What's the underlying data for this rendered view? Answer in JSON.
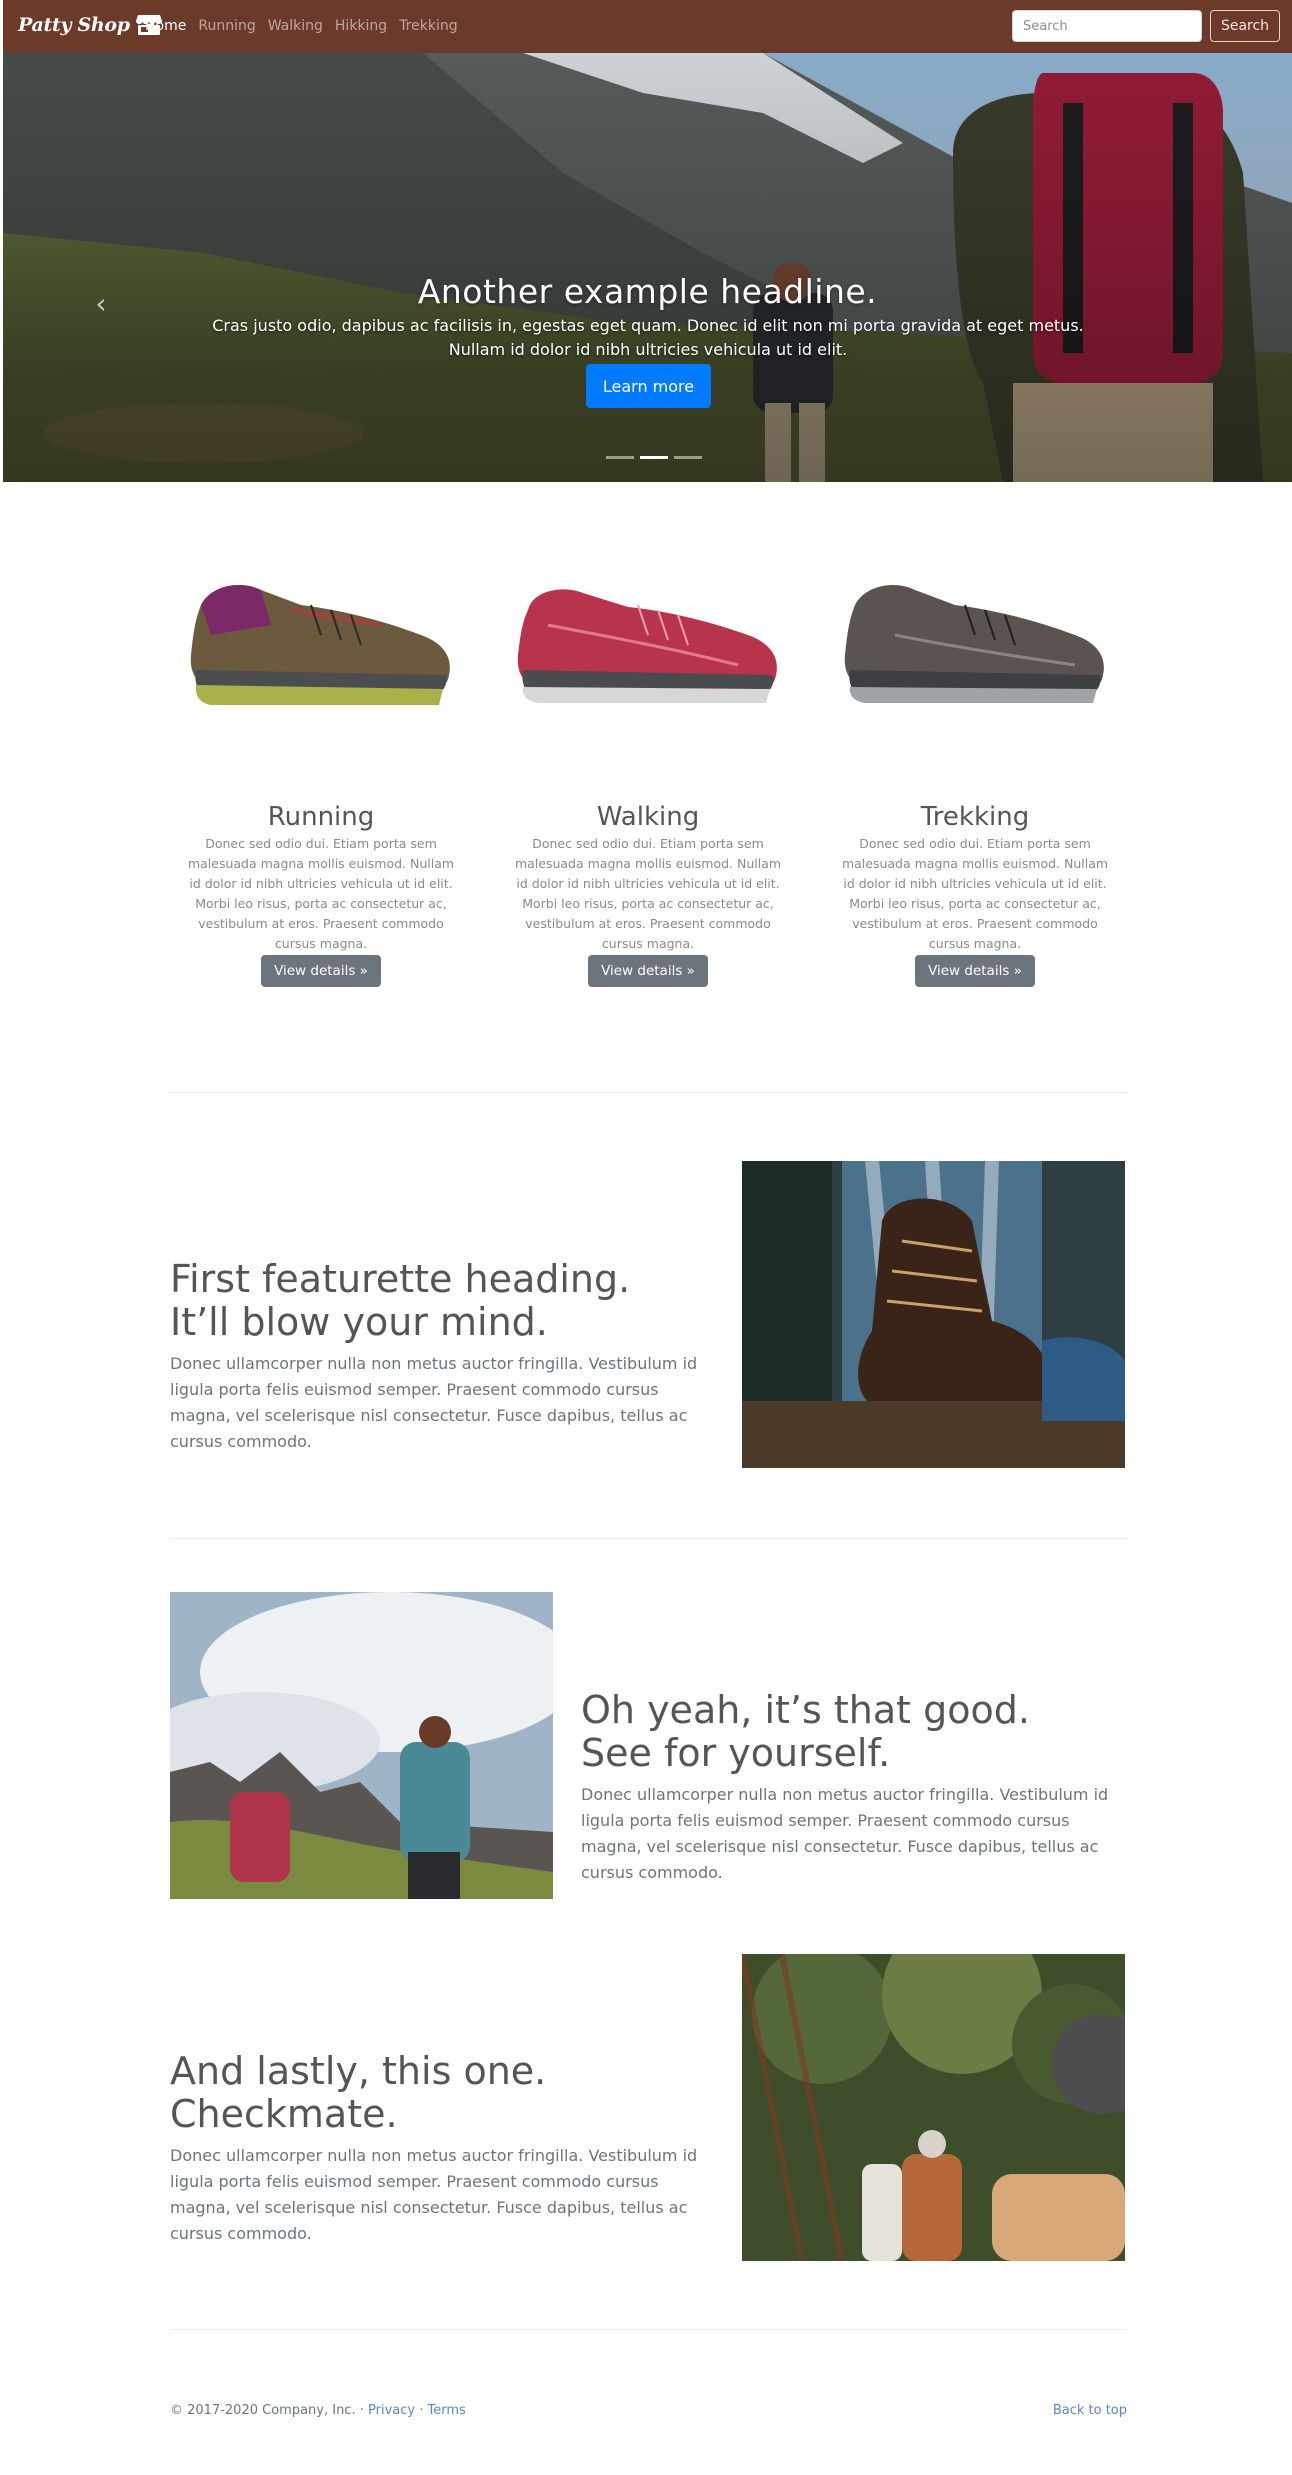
{
  "nav": {
    "brand": "Patty Shop",
    "brand_icon": "store-icon",
    "links": [
      {
        "label": "Home",
        "active": true
      },
      {
        "label": "Running",
        "active": false
      },
      {
        "label": "Walking",
        "active": false
      },
      {
        "label": "Hikking",
        "active": false
      },
      {
        "label": "Trekking",
        "active": false
      }
    ],
    "search_placeholder": "Search",
    "search_button": "Search",
    "bg_color": "#6b3a29"
  },
  "hero": {
    "headline": "Another example headline.",
    "text": "Cras justo odio, dapibus ac facilisis in, egestas eget quam. Donec id elit non mi porta gravida at eget metus. Nullam id dolor id nibh ultricies vehicula ut id elit.",
    "button": "Learn more",
    "prev_icon": "chevron-left-icon",
    "slides": 3,
    "active_slide": 2
  },
  "products": [
    {
      "title": "Running",
      "desc": "Donec sed odio dui. Etiam porta sem malesuada magna mollis euismod. Nullam id dolor id nibh ultricies vehicula ut id elit. Morbi leo risus, porta ac consectetur ac, vestibulum at eros. Praesent commodo cursus magna.",
      "button": "View details »"
    },
    {
      "title": "Walking",
      "desc": "Donec sed odio dui. Etiam porta sem malesuada magna mollis euismod. Nullam id dolor id nibh ultricies vehicula ut id elit. Morbi leo risus, porta ac consectetur ac, vestibulum at eros. Praesent commodo cursus magna.",
      "button": "View details »"
    },
    {
      "title": "Trekking",
      "desc": "Donec sed odio dui. Etiam porta sem malesuada magna mollis euismod. Nullam id dolor id nibh ultricies vehicula ut id elit. Morbi leo risus, porta ac consectetur ac, vestibulum at eros. Praesent commodo cursus magna.",
      "button": "View details »"
    }
  ],
  "featurettes": [
    {
      "heading_line1": "First featurette heading.",
      "heading_line2": "It’ll blow your mind.",
      "text": "Donec ullamcorper nulla non metus auctor fringilla. Vestibulum id ligula porta felis euismod semper. Praesent commodo cursus magna, vel scelerisque nisl consectetur. Fusce dapibus, tellus ac cursus commodo."
    },
    {
      "heading_line1": "Oh yeah, it’s that good.",
      "heading_line2": "See for yourself.",
      "text": "Donec ullamcorper nulla non metus auctor fringilla. Vestibulum id ligula porta felis euismod semper. Praesent commodo cursus magna, vel scelerisque nisl consectetur. Fusce dapibus, tellus ac cursus commodo."
    },
    {
      "heading_line1": "And lastly, this one.",
      "heading_line2": "Checkmate.",
      "text": "Donec ullamcorper nulla non metus auctor fringilla. Vestibulum id ligula porta felis euismod semper. Praesent commodo cursus magna, vel scelerisque nisl consectetur. Fusce dapibus, tellus ac cursus commodo."
    }
  ],
  "footer": {
    "copyright": "© 2017-2020 Company, Inc. ·",
    "privacy": "Privacy",
    "sep": "·",
    "terms": "Terms",
    "back_to_top": "Back to top"
  }
}
